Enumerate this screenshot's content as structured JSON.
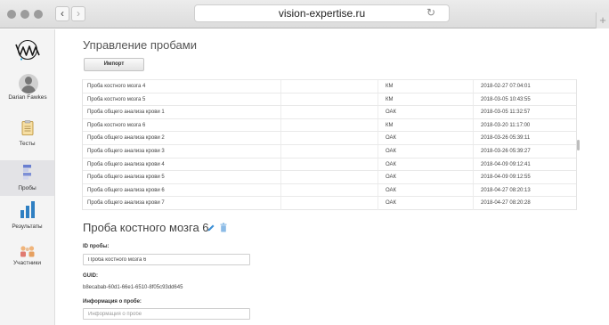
{
  "browser": {
    "url": "vision-expertise.ru"
  },
  "sidebar": {
    "user_name": "Darian Fawkes",
    "items": [
      {
        "label": "Тесты"
      },
      {
        "label": "Пробы"
      },
      {
        "label": "Результаты"
      },
      {
        "label": "Участники"
      }
    ]
  },
  "main": {
    "title": "Управление пробами",
    "import_label": "Импорт",
    "samples": [
      {
        "name": "Проба костного мозга 4",
        "type": "КМ",
        "date": "2018-02-27 07:04:01"
      },
      {
        "name": "Проба костного мозга 5",
        "type": "КМ",
        "date": "2018-03-05 10:43:55"
      },
      {
        "name": "Проба общего анализа крови 1",
        "type": "ОАК",
        "date": "2018-03-05 11:32:57"
      },
      {
        "name": "Проба костного мозга 6",
        "type": "КМ",
        "date": "2018-03-20 11:17:00"
      },
      {
        "name": "Проба общего анализа крови 2",
        "type": "ОАК",
        "date": "2018-03-26 05:39:11"
      },
      {
        "name": "Проба общего анализа крови 3",
        "type": "ОАК",
        "date": "2018-03-26 05:39:27"
      },
      {
        "name": "Проба общего анализа крови 4",
        "type": "ОАК",
        "date": "2018-04-09 09:12:41"
      },
      {
        "name": "Проба общего анализа крови 5",
        "type": "ОАК",
        "date": "2018-04-09 09:12:55"
      },
      {
        "name": "Проба общего анализа крови 6",
        "type": "ОАК",
        "date": "2018-04-27 08:20:13"
      },
      {
        "name": "Проба общего анализа крови 7",
        "type": "ОАК",
        "date": "2018-04-27 08:20:28"
      }
    ]
  },
  "detail": {
    "title": "Проба костного мозга 6",
    "id_label": "ID пробы:",
    "id_value": "Проба костного мозга 6",
    "guid_label": "GUID:",
    "guid_value": "b8ecabab-60d1-66e1-6510-8f05c93dd645",
    "info_label": "Информация о пробе:",
    "info_placeholder": "Информация о пробе"
  },
  "colors": {
    "accent": "#3b8fd6",
    "trash": "#8bbbe6"
  }
}
